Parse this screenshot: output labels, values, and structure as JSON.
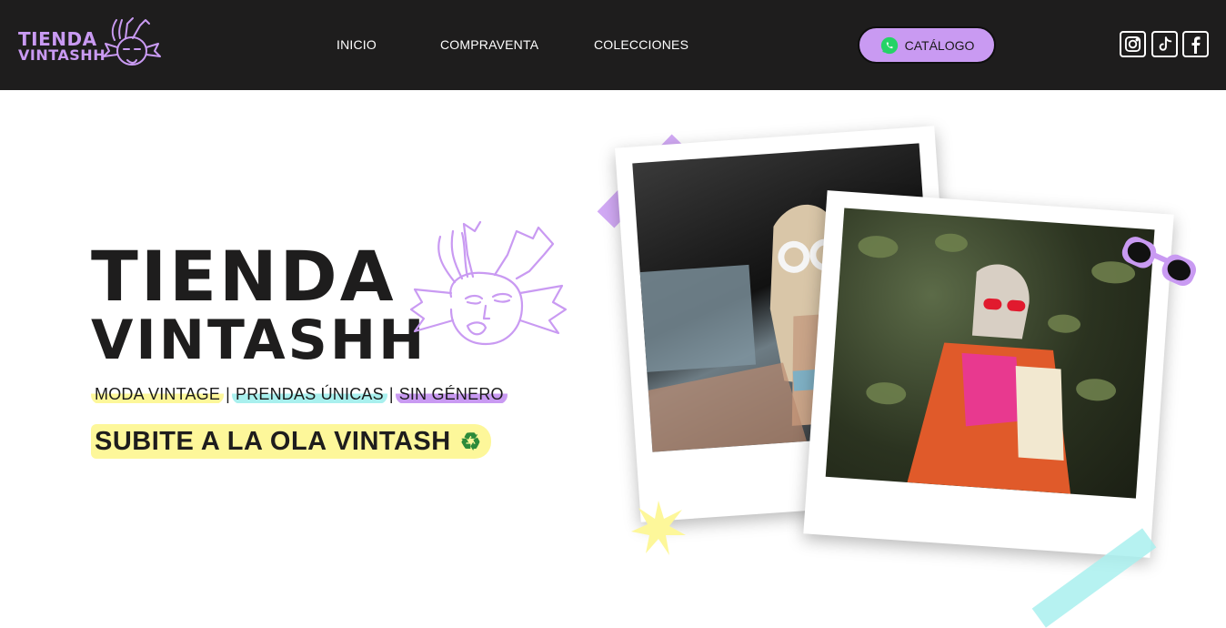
{
  "brand": {
    "line1": "TIENDA",
    "line2": "VINTASHH"
  },
  "nav": {
    "links": [
      {
        "label": "INICIO"
      },
      {
        "label": "COMPRAVENTA"
      },
      {
        "label": "COLECCIONES"
      }
    ],
    "catalog_label": "CATÁLOGO",
    "catalog_icon": "whatsapp-icon",
    "social": [
      "instagram-icon",
      "tiktok-icon",
      "facebook-icon"
    ]
  },
  "hero": {
    "title_line1": "TIENDA",
    "title_line2": "VINTASHH",
    "tags": [
      "MODA VINTAGE",
      "PRENDAS ÚNICAS",
      "SIN GÉNERO"
    ],
    "separator": "|",
    "slogan": "SUBITE A LA OLA VINTASH",
    "slogan_icon": "recycle-icon"
  },
  "colors": {
    "nav_bg": "#1e1d1d",
    "brand_purple": "#c99af2",
    "highlight_yellow": "#fdf79a",
    "highlight_cyan": "#a9f0ee"
  }
}
